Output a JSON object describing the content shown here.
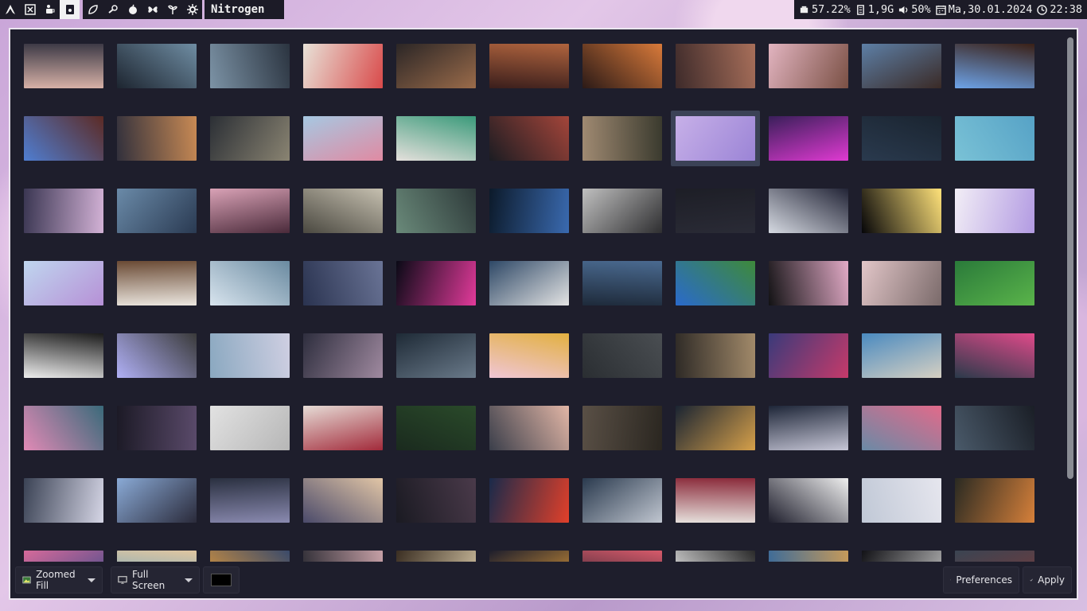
{
  "topbar": {
    "workspaces": [
      {
        "icon": "arch-icon",
        "active": false
      },
      {
        "icon": "grid-icon",
        "active": false
      },
      {
        "icon": "coffee-icon",
        "active": false
      },
      {
        "icon": "terminal-icon",
        "active": true
      }
    ],
    "apps": [
      "leaf-icon",
      "steam-icon",
      "apple-icon",
      "butterfly-icon",
      "sprout-icon",
      "settings-icon"
    ],
    "window_title": "Nitrogen",
    "status": {
      "cpu": "57.22%",
      "memory": "1,9G",
      "volume": "50%",
      "date": "Ma,30.01.2024",
      "time": "22:38"
    }
  },
  "window": {
    "selected_index": 18,
    "thumbnails": [
      {
        "c1": "#d6b0a6",
        "c2": "#3d3a46"
      },
      {
        "c1": "#1d2530",
        "c2": "#6f8da3"
      },
      {
        "c1": "#7c93a6",
        "c2": "#2b3440"
      },
      {
        "c1": "#e8e2d8",
        "c2": "#d94a4a"
      },
      {
        "c1": "#2b2626",
        "c2": "#9a6b4a"
      },
      {
        "c1": "#3a1e1c",
        "c2": "#b0643e"
      },
      {
        "c1": "#2b1a17",
        "c2": "#d97a3a"
      },
      {
        "c1": "#3d2a2a",
        "c2": "#a86f5a"
      },
      {
        "c1": "#e2b4c0",
        "c2": "#7a5044"
      },
      {
        "c1": "#5d7fa6",
        "c2": "#3a2a26"
      },
      {
        "c1": "#6da3e8",
        "c2": "#3a2016"
      },
      {
        "c1": "#4f7ed2",
        "c2": "#5c2a24"
      },
      {
        "c1": "#31303c",
        "c2": "#c98a54"
      },
      {
        "c1": "#2b2f35",
        "c2": "#8a8472"
      },
      {
        "c1": "#a6c8e2",
        "c2": "#e08aa2"
      },
      {
        "c1": "#e5e0dc",
        "c2": "#3a9a7a"
      },
      {
        "c1": "#1b1c22",
        "c2": "#a4453a"
      },
      {
        "c1": "#a08a72",
        "c2": "#3a3a2e"
      },
      {
        "c1": "#c7b0e8",
        "c2": "#9b84d6"
      },
      {
        "c1": "#3a1f5a",
        "c2": "#e03ad2"
      },
      {
        "c1": "#2a3a4e",
        "c2": "#1a2430"
      },
      {
        "c1": "#7ac2d6",
        "c2": "#56a2c6"
      },
      {
        "c1": "#3a3652",
        "c2": "#d3b2d6"
      },
      {
        "c1": "#6a8aa8",
        "c2": "#2a3a52"
      },
      {
        "c1": "#d9a2b6",
        "c2": "#4a2a3a"
      },
      {
        "c1": "#4a4840",
        "c2": "#c6c0b0"
      },
      {
        "c1": "#6a8a7a",
        "c2": "#2e3a3a"
      },
      {
        "c1": "#0c1a2a",
        "c2": "#3a6ab0"
      },
      {
        "c1": "#c0c0c0",
        "c2": "#2e2e30"
      },
      {
        "c1": "#1d1e26",
        "c2": "#2a2b36"
      },
      {
        "c1": "#d6dae2",
        "c2": "#222436"
      },
      {
        "c1": "#050508",
        "c2": "#ffe27a"
      },
      {
        "c1": "#f2eef6",
        "c2": "#b29ae2"
      },
      {
        "c1": "#bfd6ef",
        "c2": "#b690d6"
      },
      {
        "c1": "#6a4a34",
        "c2": "#ece7e0"
      },
      {
        "c1": "#d8e4ee",
        "c2": "#6a8aa0"
      },
      {
        "c1": "#2a3350",
        "c2": "#6a7496"
      },
      {
        "c1": "#0a0a16",
        "c2": "#e23a9a"
      },
      {
        "c1": "#2e4866",
        "c2": "#e4e4e4"
      },
      {
        "c1": "#1e2a3a",
        "c2": "#4a6a90"
      },
      {
        "c1": "#2a6acc",
        "c2": "#3e8a3a"
      },
      {
        "c1": "#121214",
        "c2": "#e2aac6"
      },
      {
        "c1": "#e2c6c8",
        "c2": "#7a6a6a"
      },
      {
        "c1": "#2a7a3a",
        "c2": "#5ab44a"
      },
      {
        "c1": "#ededed",
        "c2": "#1a1a1a"
      },
      {
        "c1": "#b0b0f6",
        "c2": "#3a3a3a"
      },
      {
        "c1": "#8aa8c0",
        "c2": "#cfcfe2"
      },
      {
        "c1": "#2e2e3e",
        "c2": "#a08aa0"
      },
      {
        "c1": "#1e2a36",
        "c2": "#6a7a8a"
      },
      {
        "c1": "#f0c6d6",
        "c2": "#e2b040"
      },
      {
        "c1": "#2a2e32",
        "c2": "#4a4e52"
      },
      {
        "c1": "#2e2a26",
        "c2": "#a28a6a"
      },
      {
        "c1": "#3a3a7a",
        "c2": "#c63a6a"
      },
      {
        "c1": "#4a8ac0",
        "c2": "#d6d0c2"
      },
      {
        "c1": "#2a3a4a",
        "c2": "#e04a8a"
      },
      {
        "c1": "#e28ab6",
        "c2": "#3a6a7a"
      },
      {
        "c1": "#1c1a26",
        "c2": "#5a4a6a"
      },
      {
        "c1": "#e2e2e2",
        "c2": "#b6b6b6"
      },
      {
        "c1": "#e6dcd6",
        "c2": "#a22a3a"
      },
      {
        "c1": "#1a2a1e",
        "c2": "#2a4a2a"
      },
      {
        "c1": "#3a3e4a",
        "c2": "#e2b6a6"
      },
      {
        "c1": "#5a5046",
        "c2": "#2a2620"
      },
      {
        "c1": "#1a2432",
        "c2": "#d6a04a"
      },
      {
        "c1": "#1e2638",
        "c2": "#c6c6d6"
      },
      {
        "c1": "#6a8aa6",
        "c2": "#e26a8a"
      },
      {
        "c1": "#4a5a6a",
        "c2": "#1a1e26"
      },
      {
        "c1": "#3a4254",
        "c2": "#d6d6e6"
      },
      {
        "c1": "#8aaad6",
        "c2": "#2a2a3a"
      },
      {
        "c1": "#2a3040",
        "c2": "#8a8ab0"
      },
      {
        "c1": "#4a4a6a",
        "c2": "#e2c6a6"
      },
      {
        "c1": "#1a1a22",
        "c2": "#4a3a4a"
      },
      {
        "c1": "#1a2a4a",
        "c2": "#e2402a"
      },
      {
        "c1": "#2a3a4e",
        "c2": "#c0c6d0"
      },
      {
        "c1": "#e6e0dc",
        "c2": "#8a2a3a"
      },
      {
        "c1": "#1e1e2c",
        "c2": "#efefef"
      },
      {
        "c1": "#c0c8d6",
        "c2": "#e6e6ee"
      },
      {
        "c1": "#2a2a22",
        "c2": "#d6803a"
      },
      {
        "c1": "#d66a9a",
        "c2": "#3a4a8a"
      },
      {
        "c1": "#5aa0c6",
        "c2": "#e0c6a0"
      },
      {
        "c1": "#e29a3a",
        "c2": "#3a4a6a"
      },
      {
        "c1": "#2a2a32",
        "c2": "#c6a0a6"
      },
      {
        "c1": "#3a2e22",
        "c2": "#d6c6a6"
      },
      {
        "c1": "#1e1e2c",
        "c2": "#e6a03a"
      },
      {
        "c1": "#1e1e2c",
        "c2": "#d65a6a"
      },
      {
        "c1": "#f0f0f0",
        "c2": "#2a2a2a"
      },
      {
        "c1": "#3a6a9a",
        "c2": "#c69a5a"
      },
      {
        "c1": "#121216",
        "c2": "#c0c0c0"
      },
      {
        "c1": "#3a4452",
        "c2": "#7a3a3a"
      }
    ],
    "bottom": {
      "mode_label": "Zoomed Fill",
      "screen_label": "Full Screen",
      "bg_color": "#000000",
      "preferences_label": "Preferences",
      "apply_label": "Apply"
    }
  }
}
